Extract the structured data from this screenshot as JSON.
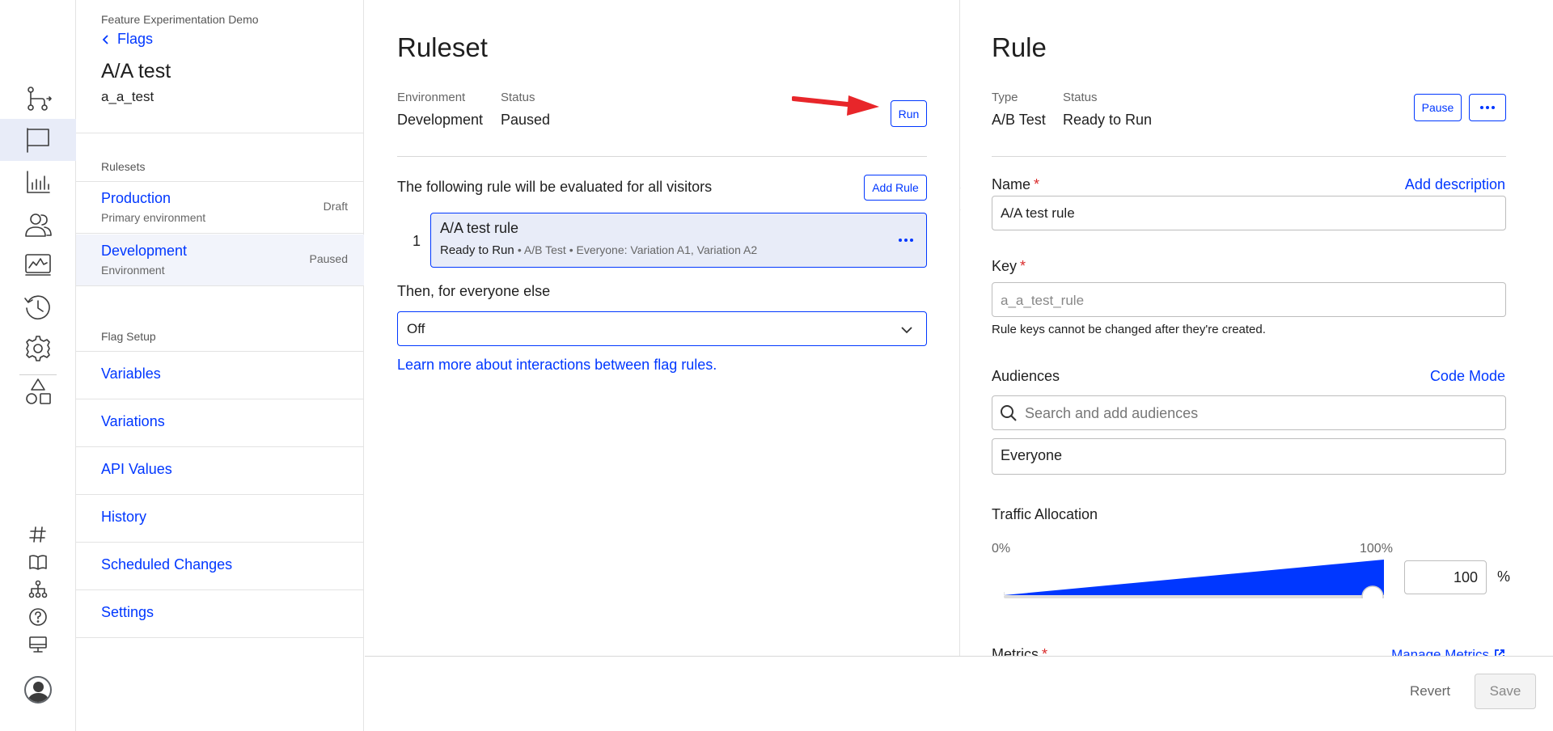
{
  "rail": {
    "icons": [
      "rulesets-icon",
      "flag-icon",
      "reports-icon",
      "audiences-icon",
      "monitor-icon",
      "history-icon",
      "settings-icon",
      "shapes-icon",
      "hash-icon",
      "book-icon",
      "hierarchy-icon",
      "help-icon",
      "desktop-icon",
      "avatar-icon"
    ]
  },
  "sidebar": {
    "project": "Feature Experimentation Demo",
    "back_label": "Flags",
    "flag_name": "A/A test",
    "flag_key": "a_a_test",
    "rulesets_title": "Rulesets",
    "rulesets": [
      {
        "name": "Production",
        "desc": "Primary environment",
        "status": "Draft"
      },
      {
        "name": "Development",
        "desc": "Environment",
        "status": "Paused"
      }
    ],
    "setup_title": "Flag Setup",
    "setup_items": [
      "Variables",
      "Variations",
      "API Values",
      "History",
      "Scheduled Changes",
      "Settings"
    ]
  },
  "ruleset": {
    "title": "Ruleset",
    "env_label": "Environment",
    "env_value": "Development",
    "status_label": "Status",
    "status_value": "Paused",
    "run_label": "Run",
    "intro": "The following rule will be evaluated for all visitors",
    "add_rule_label": "Add Rule",
    "rule": {
      "index": "1",
      "name": "A/A test rule",
      "status": "Ready to Run",
      "details": "• A/B Test • Everyone: Variation A1, Variation A2"
    },
    "else_label": "Then, for everyone else",
    "else_value": "Off",
    "learn_link": "Learn more about interactions between flag rules."
  },
  "rule": {
    "title": "Rule",
    "type_label": "Type",
    "type_value": "A/B Test",
    "status_label": "Status",
    "status_value": "Ready to Run",
    "pause_label": "Pause",
    "name_label": "Name",
    "add_description": "Add description",
    "name_value": "A/A test rule",
    "key_label": "Key",
    "key_placeholder": "a_a_test_rule",
    "key_hint": "Rule keys cannot be changed after they're created.",
    "audiences_label": "Audiences",
    "code_mode": "Code Mode",
    "audience_search_placeholder": "Search and add audiences",
    "audience_selected": "Everyone",
    "traffic_label": "Traffic Allocation",
    "scale_min": "0%",
    "scale_max": "100%",
    "traffic_value": "100",
    "traffic_fraction": 1.0,
    "percent_symbol": "%",
    "metrics_label": "Metrics",
    "manage_metrics": "Manage Metrics"
  },
  "footer": {
    "revert_label": "Revert",
    "save_label": "Save"
  },
  "colors": {
    "accent": "#0037ff",
    "selected_bg": "#e8ecf8",
    "required": "#d92b2b",
    "annotation_arrow": "#e8262a"
  }
}
